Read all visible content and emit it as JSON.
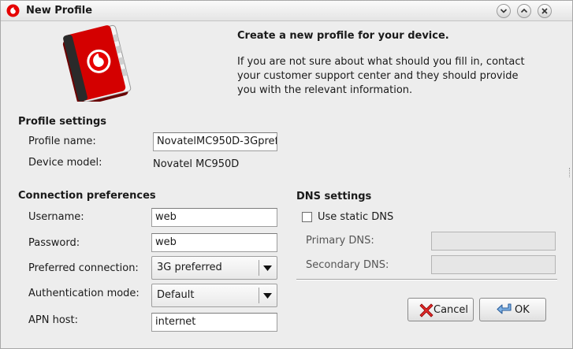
{
  "window": {
    "title": "New Profile"
  },
  "header": {
    "title": "Create a new profile for your device.",
    "body_lines": [
      "If you are not sure about what should you fill in, contact",
      "your customer support center and they should provide",
      "you with the relevant information."
    ]
  },
  "profile_settings": {
    "section_title": "Profile settings",
    "profile_name_label": "Profile name:",
    "profile_name_value": "NovatelMC950D-3Gpref",
    "device_model_label": "Device model:",
    "device_model_value": "Novatel MC950D"
  },
  "connection": {
    "section_title": "Connection preferences",
    "username_label": "Username:",
    "username_value": "web",
    "password_label": "Password:",
    "password_value": "web",
    "preferred_label": "Preferred connection:",
    "preferred_value": "3G preferred",
    "auth_label": "Authentication mode:",
    "auth_value": "Default",
    "apn_label": "APN host:",
    "apn_value": "internet"
  },
  "dns": {
    "section_title": "DNS settings",
    "static_label": "Use static DNS",
    "static_checked": false,
    "primary_label": "Primary DNS:",
    "primary_value": "",
    "secondary_label": "Secondary DNS:",
    "secondary_value": ""
  },
  "buttons": {
    "cancel": "Cancel",
    "ok": "OK"
  },
  "colors": {
    "brand_red": "#e60000",
    "window_bg": "#ededed"
  },
  "icons": {
    "app": "vodafone-logo-icon",
    "header": "address-book-icon",
    "cancel": "red-x-icon",
    "ok": "blue-arrow-enter-icon"
  }
}
